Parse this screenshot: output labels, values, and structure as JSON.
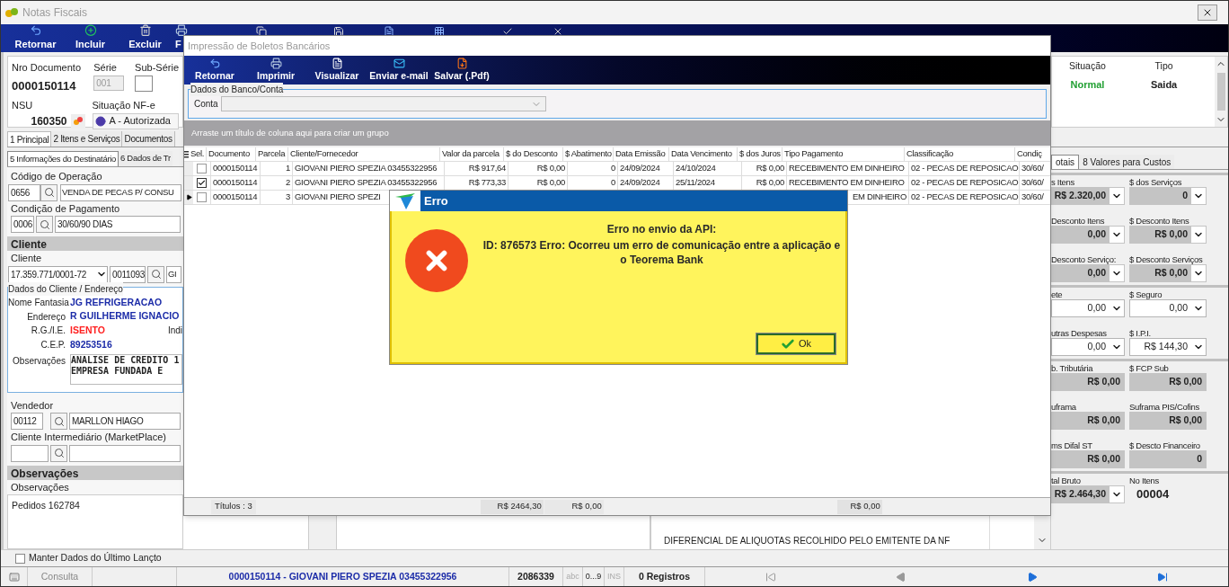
{
  "window": {
    "title": "Notas Fiscais"
  },
  "toolbar": [
    {
      "label": "Retornar",
      "kind": "back"
    },
    {
      "label": "Incluir",
      "kind": "add"
    },
    {
      "label": "Excluir",
      "kind": "delete"
    },
    {
      "label": "F",
      "kind": "print"
    }
  ],
  "header": {
    "doc_label": "Nro Documento",
    "doc_number": "0000150114",
    "serie_label": "Série",
    "serie_value": "001",
    "subserie_label": "Sub-Série",
    "nsu_label": "NSU",
    "nsu_value": "160350",
    "nfe_label": "Situação NF-e",
    "nfe_value": "A - Autorizada",
    "situacao_label": "Situação",
    "situacao_value": "Normal",
    "tipo_label": "Tipo",
    "tipo_value": "Saida"
  },
  "tabs": [
    {
      "label": "1 Principal",
      "selected": true
    },
    {
      "label": "2 Itens e Serviços",
      "selected": false
    },
    {
      "label": "Documentos",
      "selected": false
    }
  ],
  "subtabs": [
    {
      "label": "5 Informações do Destinatário",
      "selected": true
    },
    {
      "label": "6 Dados de Tr",
      "selected": false
    }
  ],
  "form": {
    "operacao_label": "Código de Operação",
    "operacao_code": "0656",
    "operacao_name": "VENDA DE PECAS P/ CONSU",
    "pagamento_label": "Condição de Pagamento",
    "pagamento_code": "0006",
    "pagamento_name": "30/60/90 DIAS",
    "cliente_section": "Cliente",
    "cliente_label": "Cliente",
    "cliente_doc": "17.359.771/0001-72",
    "cliente_code": "0011093",
    "cliente_name": "GI",
    "endereco_group": "Dados do Cliente / Endereço",
    "address": [
      {
        "label": "Nome Fantasia",
        "value": "JG REFRIGERACAO",
        "kind": "normal"
      },
      {
        "label": "Endereço",
        "value": "R GUILHERME IGNACIO",
        "kind": "normal"
      },
      {
        "label": "R.G./I.E.",
        "value": "ISENTO",
        "kind": "alert",
        "extra": "Indi"
      },
      {
        "label": "C.E.P.",
        "value": "89253516",
        "kind": "normal"
      }
    ],
    "obs_label": "Observações",
    "obs_lines": [
      "ANALISE DE CREDITO 1",
      "EMPRESA FUNDADA E"
    ],
    "vendedor_label": "Vendedor",
    "vendedor_code": "00112",
    "vendedor_name": "MARLLON HIAGO",
    "intermediario_label": "Cliente Intermediário (MarketPlace)",
    "obs_section": "Observações",
    "observacoes_label": "Observações",
    "observacoes_value": "Pedidos 162784"
  },
  "totals": {
    "tabs": [
      {
        "label": "otais",
        "selected": true
      },
      {
        "label": "8 Valores para Custos",
        "selected": false
      }
    ],
    "groups": [
      [
        {
          "label": "s Itens",
          "value": "R$ 2.320,00",
          "kind": "gray-combo"
        },
        {
          "label": "$ dos Serviços",
          "value": "0",
          "kind": "gray-combo"
        },
        {
          "label": "Desconto Itens",
          "value": "0,00",
          "kind": "gray-combo"
        },
        {
          "label": "$ Desconto Itens",
          "value": "R$ 0,00",
          "kind": "gray-combo"
        },
        {
          "label": "Desconto Serviço:",
          "value": "0,00",
          "kind": "gray-combo"
        },
        {
          "label": "$ Desconto Serviços",
          "value": "R$ 0,00",
          "kind": "gray-combo"
        }
      ],
      [
        {
          "label": "ete",
          "value": "0,00",
          "kind": "combo"
        },
        {
          "label": "$ Seguro",
          "value": "0,00",
          "kind": "combo"
        },
        {
          "label": "utras Despesas",
          "value": "0,00",
          "kind": "combo"
        },
        {
          "label": "$ I.P.I.",
          "value": "R$ 144,30",
          "kind": "combo"
        }
      ],
      [
        {
          "label": "b. Tributária",
          "value": "R$ 0,00",
          "kind": "gray"
        },
        {
          "label": "$ FCP Sub",
          "value": "R$ 0,00",
          "kind": "gray"
        },
        {
          "label": "uframa",
          "value": "R$ 0,00",
          "kind": "gray"
        },
        {
          "label": "Suframa PIS/Cofins",
          "value": "R$ 0,00",
          "kind": "gray"
        },
        {
          "label": "ms Difal ST",
          "value": "R$ 0,00",
          "kind": "gray"
        },
        {
          "label": "$ Descto Financeiro",
          "value": "0",
          "kind": "gray"
        }
      ],
      [
        {
          "label": "tal Bruto",
          "value": "R$ 2.464,30",
          "kind": "gray-combo"
        },
        {
          "label": "No Itens",
          "value": "00004",
          "kind": "text"
        }
      ]
    ]
  },
  "memo_lines": [
    "DIFERENCIAL DE ALIQUOTAS RECOLHIDO PELO EMITENTE DA NF"
  ],
  "keep_data": {
    "label": "Manter Dados do Último Lançto",
    "checked": false
  },
  "status_bar": {
    "mode": "Consulta",
    "record": "0000150114 - GIOVANI PIERO SPEZIA 03455322956",
    "code": "2086339",
    "abc": "abc",
    "digits": "0...9",
    "ins": "INS",
    "count": "0 Registros"
  },
  "boleto_dialog": {
    "title": "Impressão de Boletos Bancários",
    "toolbar": [
      {
        "label": "Retornar",
        "kind": "back"
      },
      {
        "label": "Imprimir",
        "kind": "print"
      },
      {
        "label": "Visualizar",
        "kind": "preview"
      },
      {
        "label": "Enviar e-mail",
        "kind": "email"
      },
      {
        "label": "Salvar (.Pdf)",
        "kind": "pdf"
      }
    ],
    "group_title": "Dados do Banco/Conta",
    "conta_label": "Conta",
    "group_hint": "Arraste um título de coluna aqui para criar um grupo",
    "sel_column": "Sel.",
    "columns": [
      "Documento",
      "Parcela",
      "Cliente/Fornecedor",
      "Valor da parcela",
      "$ do Desconto",
      "$ Abatimento",
      "Data Emissão",
      "Data Vencimento",
      "$ dos Juros",
      "Tipo Pagamento",
      "Classificação",
      "Condiç"
    ],
    "rows": [
      {
        "current": false,
        "selected": false,
        "cells": [
          "0000150114",
          "1",
          "GIOVANI PIERO SPEZIA 03455322956",
          "R$ 917,64",
          "R$ 0,00",
          "0",
          "24/09/2024",
          "24/10/2024",
          "R$ 0,00",
          "RECEBIMENTO EM DINHEIRO",
          "02 - PECAS DE REPOSICAO",
          "30/60/"
        ]
      },
      {
        "current": false,
        "selected": true,
        "cells": [
          "0000150114",
          "2",
          "GIOVANI PIERO SPEZIA 03455322956",
          "R$ 773,33",
          "R$ 0,00",
          "0",
          "24/09/2024",
          "25/11/2024",
          "R$ 0,00",
          "RECEBIMENTO EM DINHEIRO",
          "02 - PECAS DE REPOSICAO",
          "30/60/"
        ]
      },
      {
        "current": true,
        "selected": false,
        "cells": [
          "0000150114",
          "3",
          "GIOVANI PIERO SPEZI",
          null,
          null,
          null,
          null,
          null,
          null,
          {
            "text": "EM DINHEIRO",
            "kind": "tail"
          },
          "02 - PECAS DE REPOSICAO",
          "30/60/"
        ]
      }
    ],
    "footer": {
      "count": "Títulos : 3",
      "total_valor": "R$ 2464,30",
      "total_desconto": "R$ 0,00",
      "total_juros": "R$ 0,00"
    }
  },
  "error_dialog": {
    "title": "Erro",
    "heading": "Erro no envio da API:",
    "message": "ID: 876573 Erro: Ocorreu um erro de comunicação entre a aplicação e o Teorema Bank",
    "button": "Ok"
  }
}
